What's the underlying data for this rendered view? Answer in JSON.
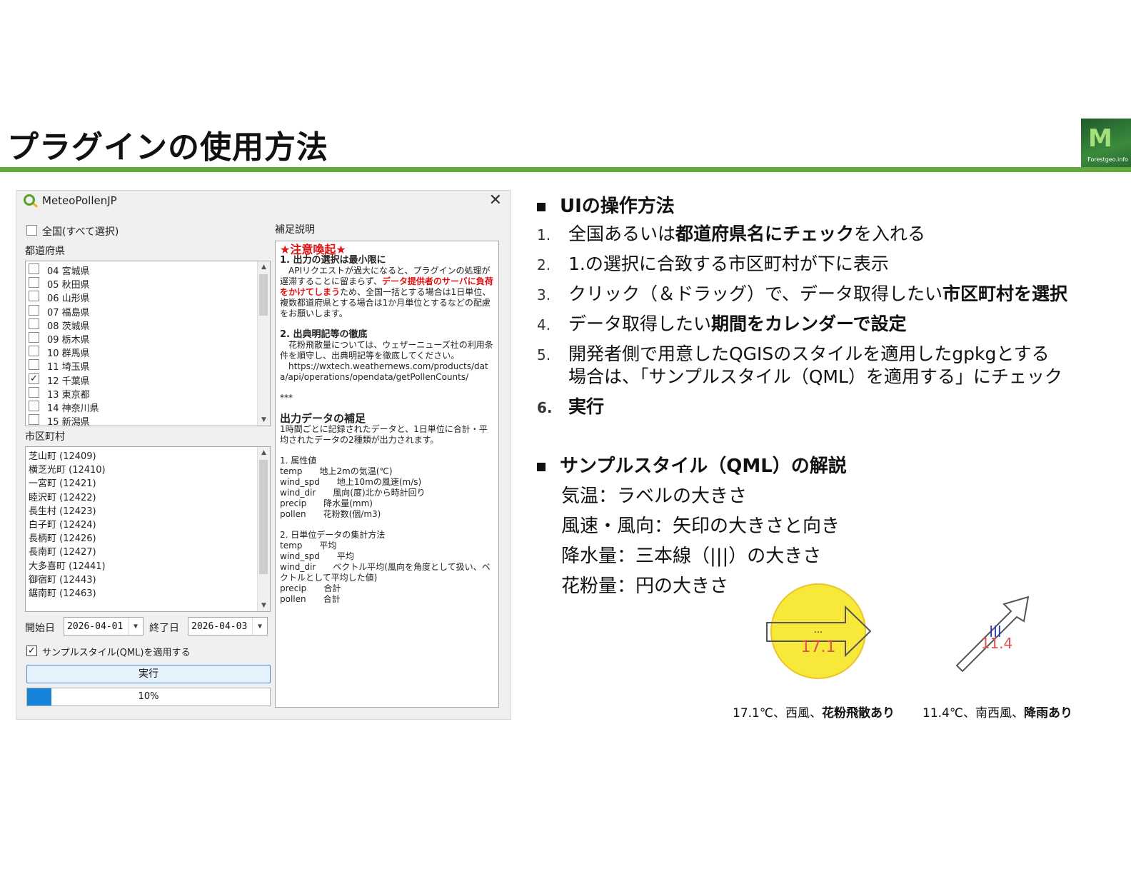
{
  "slide": {
    "title": "プラグインの使用方法",
    "logo_text": "Forestgeo.info"
  },
  "dialog": {
    "title": "MeteoPollenJP",
    "select_all_label": "全国(すべて選択)",
    "prefecture_label": "都道府県",
    "prefectures": [
      {
        "label": "04 宮城県",
        "checked": false
      },
      {
        "label": "05 秋田県",
        "checked": false
      },
      {
        "label": "06 山形県",
        "checked": false
      },
      {
        "label": "07 福島県",
        "checked": false
      },
      {
        "label": "08 茨城県",
        "checked": false
      },
      {
        "label": "09 栃木県",
        "checked": false
      },
      {
        "label": "10 群馬県",
        "checked": false
      },
      {
        "label": "11 埼玉県",
        "checked": false
      },
      {
        "label": "12 千葉県",
        "checked": true
      },
      {
        "label": "13 東京都",
        "checked": false
      },
      {
        "label": "14 神奈川県",
        "checked": false
      },
      {
        "label": "15 新潟県",
        "checked": false
      }
    ],
    "municipality_label": "市区町村",
    "municipalities": [
      "芝山町 (12409)",
      "横芝光町 (12410)",
      "一宮町 (12421)",
      "睦沢町 (12422)",
      "長生村 (12423)",
      "白子町 (12424)",
      "長柄町 (12426)",
      "長南町 (12427)",
      "大多喜町 (12441)",
      "御宿町 (12443)",
      "鋸南町 (12463)"
    ],
    "start_label": "開始日",
    "start_date": "2026-04-01",
    "end_label": "終了日",
    "end_date": "2026-04-03",
    "sample_style_label": "サンプルスタイル(QML)を適用する",
    "sample_style_checked": true,
    "run_label": "実行",
    "progress": 0.1,
    "progress_text": "10%",
    "notes_label": "補足説明",
    "notes": {
      "warning": "★注意喚起★",
      "h1": "1. 出力の選択は最小限に",
      "p1a": "　APIリクエストが過大になると、プラグインの処理が遅滞することに留まらず、",
      "p1red": "データ提供者のサーバに負荷をかけてしまう",
      "p1b": "ため、全国一括とする場合は1日単位、複数都道府県とする場合は1か月単位とするなどの配慮をお願いします。",
      "h2": "2. 出典明記等の徹底",
      "p2": "　花粉飛散量については、ウェザーニューズ社の利用条件を順守し、出典明記等を徹底してください。",
      "url": "　https://wxtech.weathernews.com/products/data/api/operations/opendata/getPollenCounts/",
      "stars": "***",
      "h3": "出力データの補足",
      "p3": "1時間ごとに記録されたデータと、1日単位に合計・平均されたデータの2種類が出力されます。",
      "attr_title": "1. 属性値",
      "attrs": [
        "temp　　地上2mの気温(℃)",
        "wind_spd　　地上10mの風速(m/s)",
        "wind_dir　　風向(度)北から時計回り",
        "precip　　降水量(mm)",
        "pollen　　花粉数(個/m3)"
      ],
      "agg_title": "2. 日単位データの集計方法",
      "aggs": [
        "temp　　平均",
        "wind_spd　　平均",
        "wind_dir　　ベクトル平均(風向を角度として扱い、ベクトルとして平均した値)",
        "precip　　合計",
        "pollen　　合計"
      ]
    }
  },
  "ui_section": {
    "heading": "UIの操作方法",
    "steps": [
      {
        "num": "1.",
        "pre": "全国あるいは",
        "bold": "都道府県名にチェック",
        "post": "を入れる"
      },
      {
        "num": "2.",
        "pre": "1.の選択に合致する市区町村が下に表示",
        "bold": "",
        "post": ""
      },
      {
        "num": "3.",
        "pre": "クリック（＆ドラッグ）で、データ取得したい",
        "bold": "市区町村を選択",
        "post": ""
      },
      {
        "num": "4.",
        "pre": "データ取得したい",
        "bold": "期間をカレンダーで設定",
        "post": ""
      },
      {
        "num": "5.",
        "pre": "開発者側で用意したQGISのスタイルを適用したgpkgとする",
        "bold": "",
        "post": ""
      },
      {
        "num": "",
        "pre": "場合は、「サンプルスタイル（QML）を適用する」にチェック",
        "bold": "",
        "post": ""
      },
      {
        "num": "6.",
        "pre": "",
        "bold": "実行",
        "post": ""
      }
    ]
  },
  "style_section": {
    "heading": "サンプルスタイル（QML）の解説",
    "items": [
      "気温：ラベルの大きさ",
      "風速・風向：矢印の大きさと向き",
      "降水量：三本線（|||）の大きさ",
      "花粉量：円の大きさ"
    ]
  },
  "examples": [
    {
      "label_text": "17.1",
      "caption_pre": "17.1℃、西風、",
      "caption_bold": "花粉飛散あり"
    },
    {
      "label_text": "11.4",
      "caption_pre": "11.4℃、南西風、",
      "caption_bold": "降雨あり"
    }
  ],
  "colors": {
    "accent_green": "#63a93a",
    "warning_red": "#e01010",
    "progress_blue": "#1683d8",
    "pollen_yellow": "#f7e83a"
  }
}
